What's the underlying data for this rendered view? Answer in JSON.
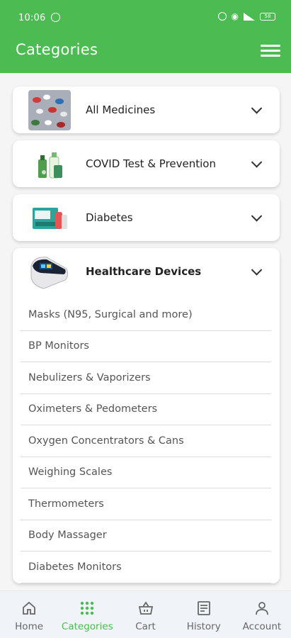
{
  "status_bar": {
    "time": "10:06",
    "battery": "58"
  },
  "header": {
    "title": "Categories"
  },
  "categories": [
    {
      "label": "All Medicines",
      "expanded": false
    },
    {
      "label": "COVID Test & Prevention",
      "expanded": false
    },
    {
      "label": "Diabetes",
      "expanded": false
    },
    {
      "label": "Healthcare Devices",
      "expanded": true,
      "subcategories": [
        "Masks (N95, Surgical and more)",
        "BP Monitors",
        "Nebulizers & Vaporizers",
        "Oximeters & Pedometers",
        "Oxygen Concentrators & Cans",
        "Weighing Scales",
        "Thermometers",
        "Body Massager",
        "Diabetes Monitors"
      ]
    }
  ],
  "bottom_nav": [
    {
      "label": "Home",
      "icon": "home-icon",
      "active": false
    },
    {
      "label": "Categories",
      "icon": "grid-icon",
      "active": true
    },
    {
      "label": "Cart",
      "icon": "basket-icon",
      "active": false
    },
    {
      "label": "History",
      "icon": "history-icon",
      "active": false
    },
    {
      "label": "Account",
      "icon": "person-icon",
      "active": false
    }
  ],
  "colors": {
    "primary": "#4cbb52",
    "nav_background": "#f0f4f8",
    "inactive": "#666666"
  }
}
